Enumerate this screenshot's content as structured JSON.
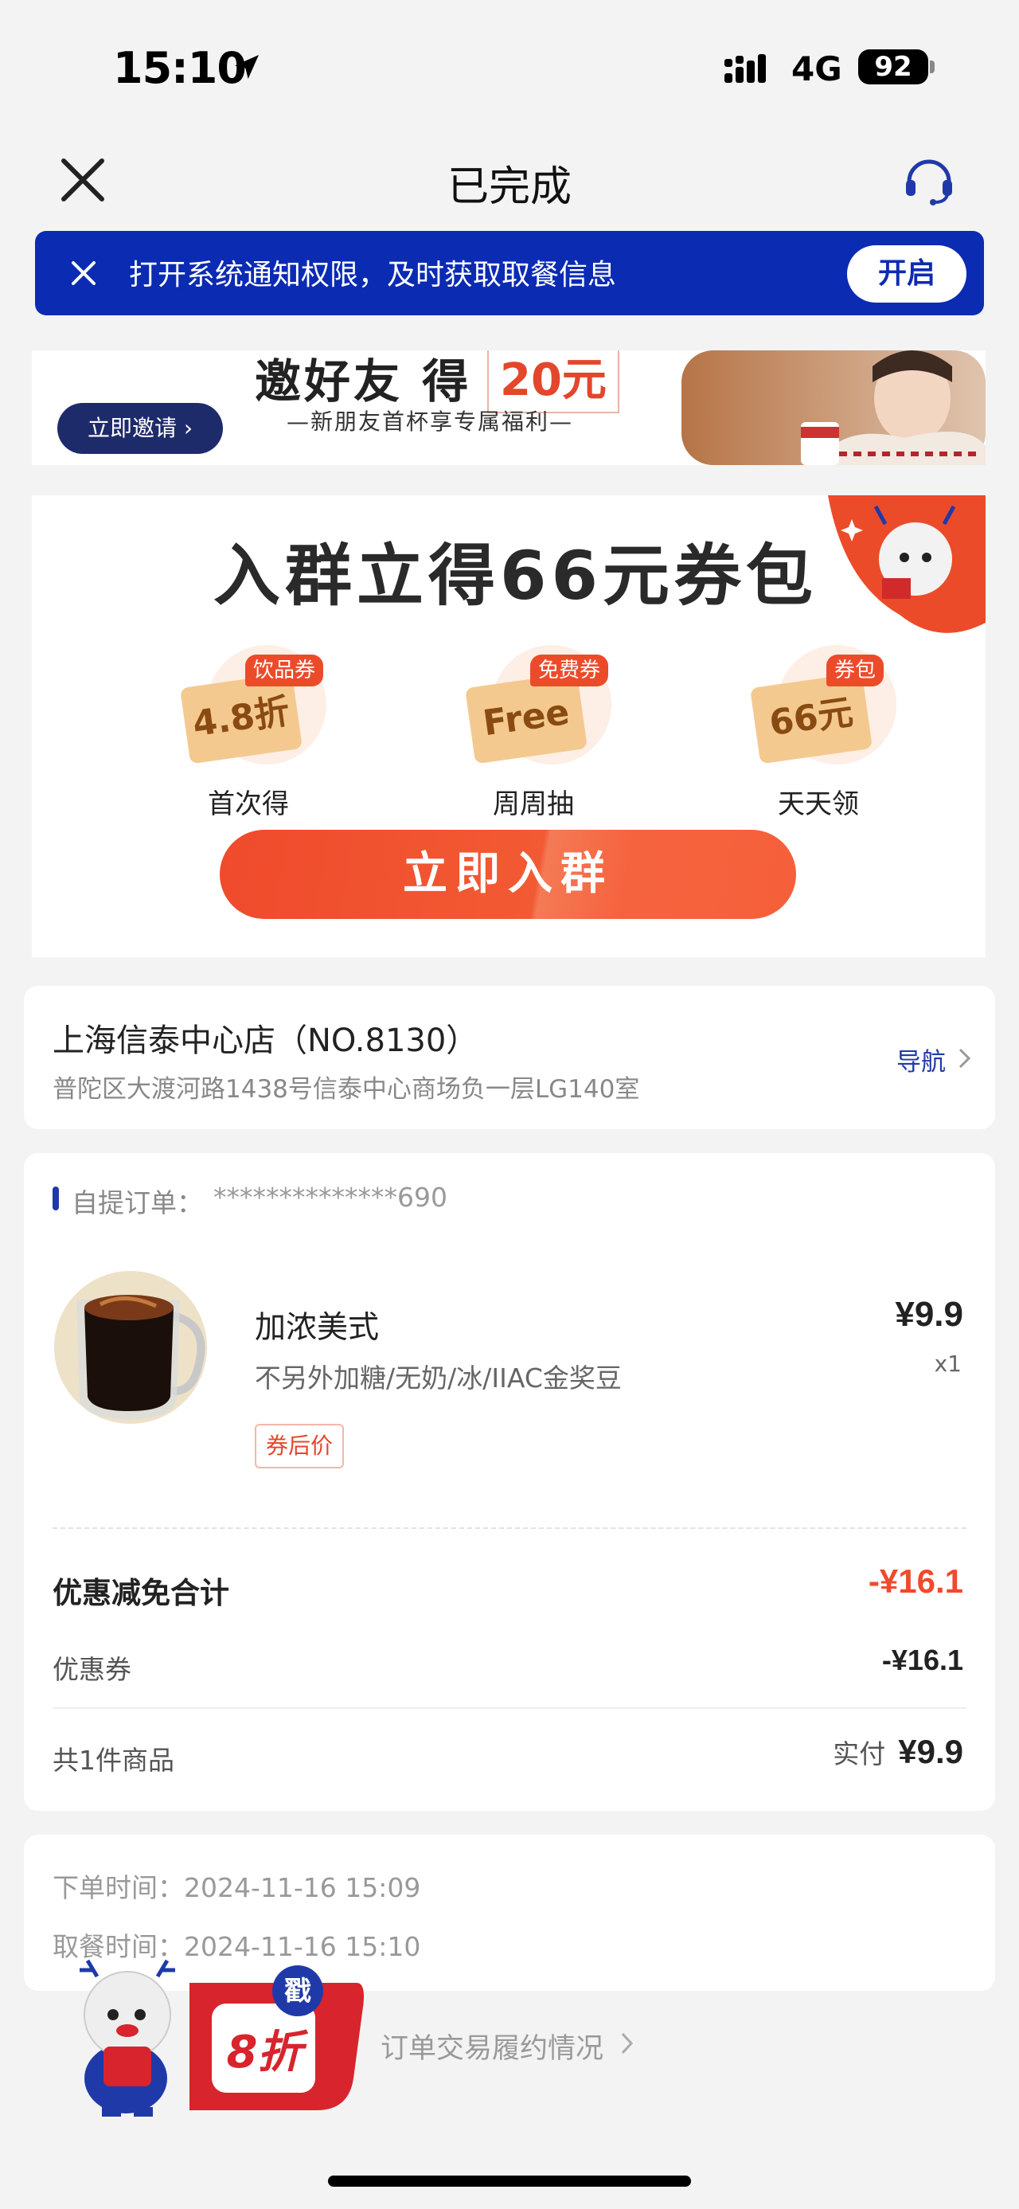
{
  "status_bar": {
    "time": "15:10",
    "network": "4G",
    "battery": "92"
  },
  "nav": {
    "title": "已完成"
  },
  "notice": {
    "text": "打开系统通知权限，及时获取取餐信息",
    "button": "开启"
  },
  "invite_banner": {
    "title": "邀好友 得",
    "amount": "20元",
    "subtitle": "—新朋友首杯享专属福利—",
    "button": "立即邀请"
  },
  "group_banner": {
    "title": "入群立得66元券包",
    "perks": [
      {
        "tag": "饮品券",
        "ticket": "4.8折",
        "label": "首次得"
      },
      {
        "tag": "免费券",
        "ticket": "Free",
        "label": "周周抽"
      },
      {
        "tag": "券包",
        "ticket": "66元",
        "label": "天天领"
      }
    ],
    "button": "立即入群"
  },
  "store": {
    "name": "上海信泰中心店（NO.8130）",
    "address": "普陀区大渡河路1438号信泰中心商场负一层LG140室",
    "nav_label": "导航"
  },
  "order": {
    "number_label": "自提订单：",
    "number": "**************690",
    "item": {
      "name": "加浓美式",
      "spec": "不另外加糖/无奶/冰/IIAC金奖豆",
      "tag": "券后价",
      "price": "¥9.9",
      "qty": "x1"
    },
    "discount_total_label": "优惠减免合计",
    "discount_total": "-¥16.1",
    "coupon_label": "优惠券",
    "coupon_value": "-¥16.1",
    "count_label": "共1件商品",
    "paid_label": "实付",
    "paid_value": "¥9.9"
  },
  "times": {
    "order_time": "下单时间：2024-11-16 15:09",
    "pickup_time": "取餐时间：2024-11-16 15:10"
  },
  "performance_link": "订单交易履约情况",
  "floating_promo": {
    "badge": "戳",
    "discount": "8折"
  },
  "colors": {
    "brand_blue": "#0b2bb3",
    "accent_red": "#ef4a2c"
  }
}
